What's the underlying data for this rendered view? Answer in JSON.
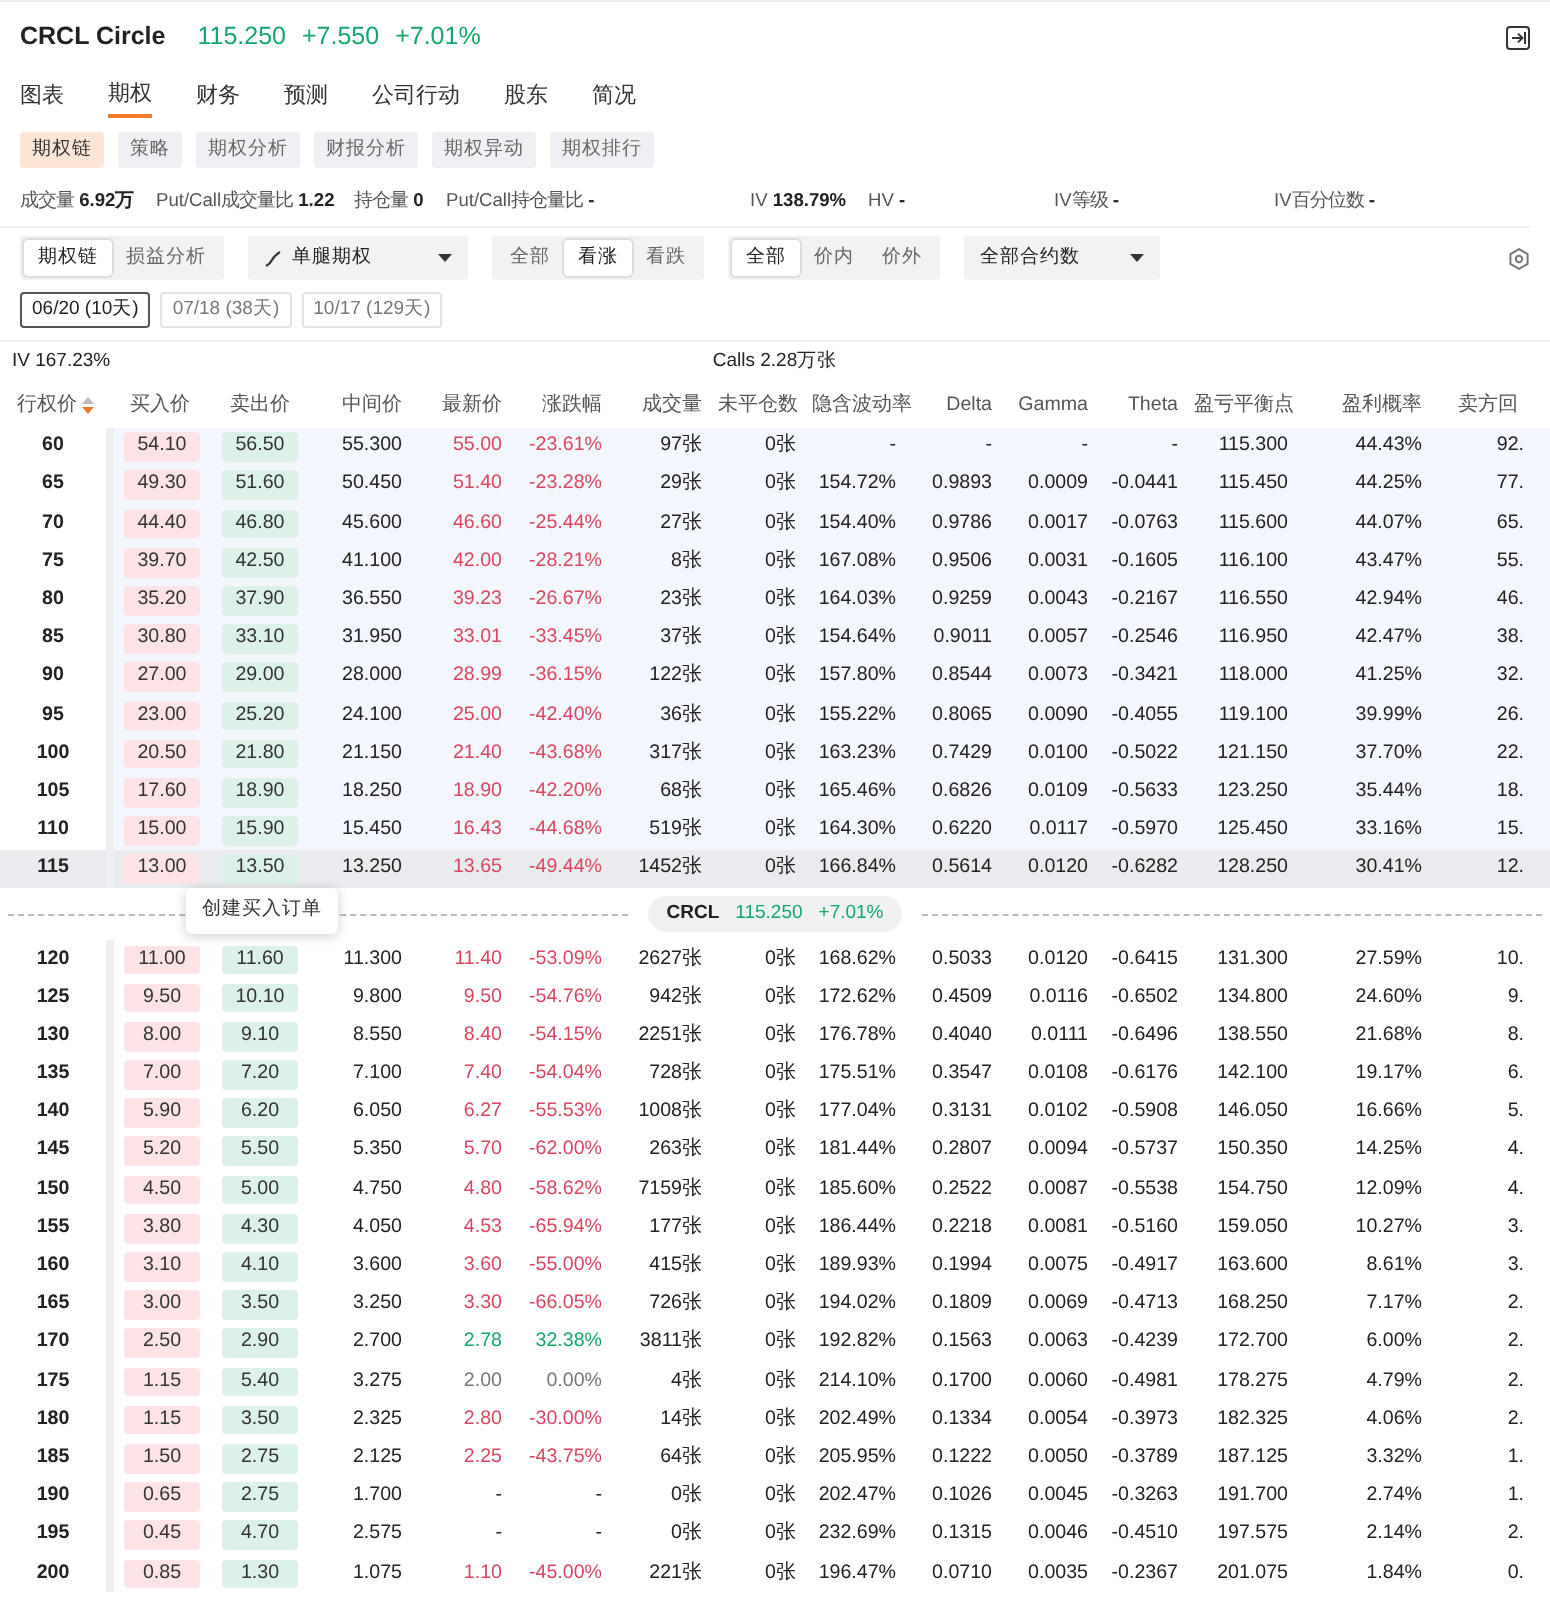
{
  "header": {
    "symbol": "CRCL Circle",
    "price": "115.250",
    "change": "+7.550",
    "change_pct": "+7.01%"
  },
  "tabs": [
    {
      "label": "图表",
      "selected": false
    },
    {
      "label": "期权",
      "selected": true
    },
    {
      "label": "财务",
      "selected": false
    },
    {
      "label": "预测",
      "selected": false
    },
    {
      "label": "公司行动",
      "selected": false
    },
    {
      "label": "股东",
      "selected": false
    },
    {
      "label": "简况",
      "selected": false
    }
  ],
  "subtabs": [
    {
      "label": "期权链",
      "selected": true
    },
    {
      "label": "策略",
      "selected": false
    },
    {
      "label": "期权分析",
      "selected": false
    },
    {
      "label": "财报分析",
      "selected": false
    },
    {
      "label": "期权异动",
      "selected": false
    },
    {
      "label": "期权排行",
      "selected": false
    }
  ],
  "stats": [
    {
      "label": "成交量",
      "value": "6.92万"
    },
    {
      "label": "Put/Call成交量比",
      "value": "1.22"
    },
    {
      "label": "持仓量",
      "value": "0"
    },
    {
      "label": "Put/Call持仓量比",
      "value": "-"
    },
    {
      "label": "IV",
      "value": "138.79%"
    },
    {
      "label": "HV",
      "value": "-"
    },
    {
      "label": "IV等级",
      "value": "-"
    },
    {
      "label": "IV百分位数",
      "value": "-"
    }
  ],
  "toolbar": [
    {
      "kind": "segmented",
      "options": [
        {
          "label": "期权链",
          "selected": true
        },
        {
          "label": "损益分析",
          "selected": false
        }
      ]
    },
    {
      "kind": "dropdown",
      "value": "单腿期权",
      "icon": true
    },
    {
      "kind": "segmented",
      "options": [
        {
          "label": "全部",
          "selected": false
        },
        {
          "label": "看涨",
          "selected": true
        },
        {
          "label": "看跌",
          "selected": false
        }
      ]
    },
    {
      "kind": "segmented",
      "options": [
        {
          "label": "全部",
          "selected": true
        },
        {
          "label": "价内",
          "selected": false
        },
        {
          "label": "价外",
          "selected": false
        }
      ]
    },
    {
      "kind": "dropdown",
      "value": "全部合约数",
      "icon": false
    }
  ],
  "expiries": [
    {
      "label": "06/20 (10天)",
      "selected": true
    },
    {
      "label": "07/18 (38天)",
      "selected": false
    },
    {
      "label": "10/17 (129天)",
      "selected": false
    }
  ],
  "summary": {
    "iv": "IV 167.23%",
    "calls": "Calls 2.28万张"
  },
  "columns": [
    "行权价",
    "买入价",
    "卖出价",
    "中间价",
    "最新价",
    "涨跌幅",
    "成交量",
    "未平仓数",
    "隐含波动率",
    "Delta",
    "Gamma",
    "Theta",
    "盈亏平衡点",
    "盈利概率",
    "卖方回"
  ],
  "rows": [
    {
      "cells": [
        "60",
        "54.10",
        "56.50",
        "55.300",
        "55.00",
        "-23.61%",
        "97张",
        "0张",
        "-",
        "-",
        "-",
        "-",
        "115.300",
        "44.43%",
        "92."
      ],
      "kind": "down",
      "in_the_money": true,
      "selected": false
    },
    {
      "cells": [
        "65",
        "49.30",
        "51.60",
        "50.450",
        "51.40",
        "-23.28%",
        "29张",
        "0张",
        "154.72%",
        "0.9893",
        "0.0009",
        "-0.0441",
        "115.450",
        "44.25%",
        "77."
      ],
      "kind": "down",
      "in_the_money": true,
      "selected": false
    },
    {
      "cells": [
        "70",
        "44.40",
        "46.80",
        "45.600",
        "46.60",
        "-25.44%",
        "27张",
        "0张",
        "154.40%",
        "0.9786",
        "0.0017",
        "-0.0763",
        "115.600",
        "44.07%",
        "65."
      ],
      "kind": "down",
      "in_the_money": true,
      "selected": false
    },
    {
      "cells": [
        "75",
        "39.70",
        "42.50",
        "41.100",
        "42.00",
        "-28.21%",
        "8张",
        "0张",
        "167.08%",
        "0.9506",
        "0.0031",
        "-0.1605",
        "116.100",
        "43.47%",
        "55."
      ],
      "kind": "down",
      "in_the_money": true,
      "selected": false
    },
    {
      "cells": [
        "80",
        "35.20",
        "37.90",
        "36.550",
        "39.23",
        "-26.67%",
        "23张",
        "0张",
        "164.03%",
        "0.9259",
        "0.0043",
        "-0.2167",
        "116.550",
        "42.94%",
        "46."
      ],
      "kind": "down",
      "in_the_money": true,
      "selected": false
    },
    {
      "cells": [
        "85",
        "30.80",
        "33.10",
        "31.950",
        "33.01",
        "-33.45%",
        "37张",
        "0张",
        "154.64%",
        "0.9011",
        "0.0057",
        "-0.2546",
        "116.950",
        "42.47%",
        "38."
      ],
      "kind": "down",
      "in_the_money": true,
      "selected": false
    },
    {
      "cells": [
        "90",
        "27.00",
        "29.00",
        "28.000",
        "28.99",
        "-36.15%",
        "122张",
        "0张",
        "157.80%",
        "0.8544",
        "0.0073",
        "-0.3421",
        "118.000",
        "41.25%",
        "32."
      ],
      "kind": "down",
      "in_the_money": true,
      "selected": false
    },
    {
      "cells": [
        "95",
        "23.00",
        "25.20",
        "24.100",
        "25.00",
        "-42.40%",
        "36张",
        "0张",
        "155.22%",
        "0.8065",
        "0.0090",
        "-0.4055",
        "119.100",
        "39.99%",
        "26."
      ],
      "kind": "down",
      "in_the_money": true,
      "selected": false
    },
    {
      "cells": [
        "100",
        "20.50",
        "21.80",
        "21.150",
        "21.40",
        "-43.68%",
        "317张",
        "0张",
        "163.23%",
        "0.7429",
        "0.0100",
        "-0.5022",
        "121.150",
        "37.70%",
        "22."
      ],
      "kind": "down",
      "in_the_money": true,
      "selected": false
    },
    {
      "cells": [
        "105",
        "17.60",
        "18.90",
        "18.250",
        "18.90",
        "-42.20%",
        "68张",
        "0张",
        "165.46%",
        "0.6826",
        "0.0109",
        "-0.5633",
        "123.250",
        "35.44%",
        "18."
      ],
      "kind": "down",
      "in_the_money": true,
      "selected": false
    },
    {
      "cells": [
        "110",
        "15.00",
        "15.90",
        "15.450",
        "16.43",
        "-44.68%",
        "519张",
        "0张",
        "164.30%",
        "0.6220",
        "0.0117",
        "-0.5970",
        "125.450",
        "33.16%",
        "15."
      ],
      "kind": "down",
      "in_the_money": true,
      "selected": false
    },
    {
      "cells": [
        "115",
        "13.00",
        "13.50",
        "13.250",
        "13.65",
        "-49.44%",
        "1452张",
        "0张",
        "166.84%",
        "0.5614",
        "0.0120",
        "-0.6282",
        "128.250",
        "30.41%",
        "12."
      ],
      "kind": "down",
      "in_the_money": true,
      "selected": true
    },
    {
      "cells": [
        "120",
        "11.00",
        "11.60",
        "11.300",
        "11.40",
        "-53.09%",
        "2627张",
        "0张",
        "168.62%",
        "0.5033",
        "0.0120",
        "-0.6415",
        "131.300",
        "27.59%",
        "10."
      ],
      "kind": "down",
      "in_the_money": false,
      "selected": false
    },
    {
      "cells": [
        "125",
        "9.50",
        "10.10",
        "9.800",
        "9.50",
        "-54.76%",
        "942张",
        "0张",
        "172.62%",
        "0.4509",
        "0.0116",
        "-0.6502",
        "134.800",
        "24.60%",
        "9."
      ],
      "kind": "down",
      "in_the_money": false,
      "selected": false
    },
    {
      "cells": [
        "130",
        "8.00",
        "9.10",
        "8.550",
        "8.40",
        "-54.15%",
        "2251张",
        "0张",
        "176.78%",
        "0.4040",
        "0.0111",
        "-0.6496",
        "138.550",
        "21.68%",
        "8."
      ],
      "kind": "down",
      "in_the_money": false,
      "selected": false
    },
    {
      "cells": [
        "135",
        "7.00",
        "7.20",
        "7.100",
        "7.40",
        "-54.04%",
        "728张",
        "0张",
        "175.51%",
        "0.3547",
        "0.0108",
        "-0.6176",
        "142.100",
        "19.17%",
        "6."
      ],
      "kind": "down",
      "in_the_money": false,
      "selected": false
    },
    {
      "cells": [
        "140",
        "5.90",
        "6.20",
        "6.050",
        "6.27",
        "-55.53%",
        "1008张",
        "0张",
        "177.04%",
        "0.3131",
        "0.0102",
        "-0.5908",
        "146.050",
        "16.66%",
        "5."
      ],
      "kind": "down",
      "in_the_money": false,
      "selected": false
    },
    {
      "cells": [
        "145",
        "5.20",
        "5.50",
        "5.350",
        "5.70",
        "-62.00%",
        "263张",
        "0张",
        "181.44%",
        "0.2807",
        "0.0094",
        "-0.5737",
        "150.350",
        "14.25%",
        "4."
      ],
      "kind": "down",
      "in_the_money": false,
      "selected": false
    },
    {
      "cells": [
        "150",
        "4.50",
        "5.00",
        "4.750",
        "4.80",
        "-58.62%",
        "7159张",
        "0张",
        "185.60%",
        "0.2522",
        "0.0087",
        "-0.5538",
        "154.750",
        "12.09%",
        "4."
      ],
      "kind": "down",
      "in_the_money": false,
      "selected": false
    },
    {
      "cells": [
        "155",
        "3.80",
        "4.30",
        "4.050",
        "4.53",
        "-65.94%",
        "177张",
        "0张",
        "186.44%",
        "0.2218",
        "0.0081",
        "-0.5160",
        "159.050",
        "10.27%",
        "3."
      ],
      "kind": "down",
      "in_the_money": false,
      "selected": false
    },
    {
      "cells": [
        "160",
        "3.10",
        "4.10",
        "3.600",
        "3.60",
        "-55.00%",
        "415张",
        "0张",
        "189.93%",
        "0.1994",
        "0.0075",
        "-0.4917",
        "163.600",
        "8.61%",
        "3."
      ],
      "kind": "down",
      "in_the_money": false,
      "selected": false
    },
    {
      "cells": [
        "165",
        "3.00",
        "3.50",
        "3.250",
        "3.30",
        "-66.05%",
        "726张",
        "0张",
        "194.02%",
        "0.1809",
        "0.0069",
        "-0.4713",
        "168.250",
        "7.17%",
        "2."
      ],
      "kind": "down",
      "in_the_money": false,
      "selected": false
    },
    {
      "cells": [
        "170",
        "2.50",
        "2.90",
        "2.700",
        "2.78",
        "32.38%",
        "3811张",
        "0张",
        "192.82%",
        "0.1563",
        "0.0063",
        "-0.4239",
        "172.700",
        "6.00%",
        "2."
      ],
      "kind": "up",
      "in_the_money": false,
      "selected": false
    },
    {
      "cells": [
        "175",
        "1.15",
        "5.40",
        "3.275",
        "2.00",
        "0.00%",
        "4张",
        "0张",
        "214.10%",
        "0.1700",
        "0.0060",
        "-0.4981",
        "178.275",
        "4.79%",
        "2."
      ],
      "kind": "flat",
      "in_the_money": false,
      "selected": false
    },
    {
      "cells": [
        "180",
        "1.15",
        "3.50",
        "2.325",
        "2.80",
        "-30.00%",
        "14张",
        "0张",
        "202.49%",
        "0.1334",
        "0.0054",
        "-0.3973",
        "182.325",
        "4.06%",
        "2."
      ],
      "kind": "down",
      "in_the_money": false,
      "selected": false
    },
    {
      "cells": [
        "185",
        "1.50",
        "2.75",
        "2.125",
        "2.25",
        "-43.75%",
        "64张",
        "0张",
        "205.95%",
        "0.1222",
        "0.0050",
        "-0.3789",
        "187.125",
        "3.32%",
        "1."
      ],
      "kind": "down",
      "in_the_money": false,
      "selected": false
    },
    {
      "cells": [
        "190",
        "0.65",
        "2.75",
        "1.700",
        "-",
        "-",
        "0张",
        "0张",
        "202.47%",
        "0.1026",
        "0.0045",
        "-0.3263",
        "191.700",
        "2.74%",
        "1."
      ],
      "kind": "none",
      "in_the_money": false,
      "selected": false
    },
    {
      "cells": [
        "195",
        "0.45",
        "4.70",
        "2.575",
        "-",
        "-",
        "0张",
        "0张",
        "232.69%",
        "0.1315",
        "0.0046",
        "-0.4510",
        "197.575",
        "2.14%",
        "2."
      ],
      "kind": "none",
      "in_the_money": false,
      "selected": false
    },
    {
      "cells": [
        "200",
        "0.85",
        "1.30",
        "1.075",
        "1.10",
        "-45.00%",
        "221张",
        "0张",
        "196.47%",
        "0.0710",
        "0.0035",
        "-0.2367",
        "201.075",
        "1.84%",
        "0."
      ],
      "kind": "down",
      "in_the_money": false,
      "selected": false
    }
  ],
  "price_divider": {
    "symbol": "CRCL",
    "price": "115.250",
    "change_pct": "+7.01%"
  },
  "tooltip": {
    "text": "创建买入订单"
  }
}
